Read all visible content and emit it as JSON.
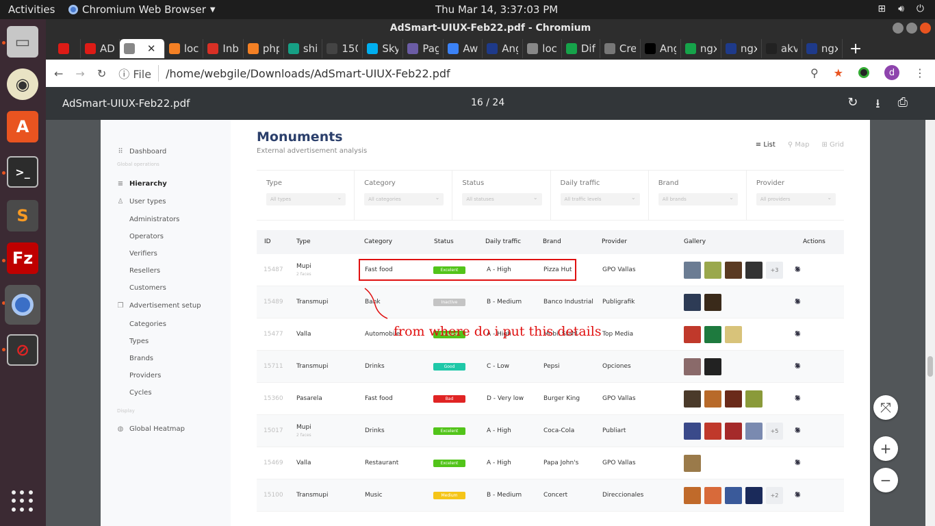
{
  "system": {
    "activities": "Activities",
    "app_name": "Chromium Web Browser",
    "clock": "Thu Mar 14,  3:37:03 PM"
  },
  "dock": {
    "items": [
      "Files",
      "Rhythmbox",
      "Software",
      "Terminal",
      "Sublime",
      "FileZilla",
      "Chromium",
      "Blocked"
    ]
  },
  "window": {
    "title": "AdSmart-UIUX-Feb22.pdf - Chromium"
  },
  "tabs": [
    {
      "label": "",
      "icon": "angular-icon",
      "color": "#dd1b16"
    },
    {
      "label": "AD",
      "icon": "angular-icon",
      "color": "#dd1b16"
    },
    {
      "label": "",
      "icon": "document-icon",
      "color": "#888888",
      "active": true
    },
    {
      "label": "loc",
      "icon": "stack-icon",
      "color": "#f48024"
    },
    {
      "label": "Inb",
      "icon": "gmail-icon",
      "color": "#d93025"
    },
    {
      "label": "php",
      "icon": "stack-icon",
      "color": "#f48024"
    },
    {
      "label": "shi",
      "icon": "at-icon",
      "color": "#16a085"
    },
    {
      "label": "150",
      "icon": "cloud-icon",
      "color": "#444444"
    },
    {
      "label": "Sky",
      "icon": "skype-icon",
      "color": "#00aff0"
    },
    {
      "label": "Pag",
      "icon": "p-icon",
      "color": "#6b5ca5"
    },
    {
      "label": "Aw",
      "icon": "circle-icon",
      "color": "#3b82f6"
    },
    {
      "label": "Ang",
      "icon": "b-icon",
      "color": "#1e3a8a"
    },
    {
      "label": "loc",
      "icon": "document-icon",
      "color": "#888888"
    },
    {
      "label": "Dif",
      "icon": "d-icon",
      "color": "#16a34a"
    },
    {
      "label": "Cre",
      "icon": "gear-icon",
      "color": "#777777"
    },
    {
      "label": "Ang",
      "icon": "m-icon",
      "color": "#000000"
    },
    {
      "label": "ngx",
      "icon": "chart-icon",
      "color": "#16a34a"
    },
    {
      "label": "ngx",
      "icon": "grid-icon",
      "color": "#1e3a8a"
    },
    {
      "label": "akv",
      "icon": "github-icon",
      "color": "#222222"
    },
    {
      "label": "ngx",
      "icon": "grid-icon",
      "color": "#1e3a8a"
    }
  ],
  "omnibox": {
    "scheme_label": "File",
    "url": "/home/webgile/Downloads/AdSmart-UIUX-Feb22.pdf",
    "avatar_letter": "d"
  },
  "pdf": {
    "filename": "AdSmart-UIUX-Feb22.pdf",
    "page_indicator": "16 / 24"
  },
  "sidebar": {
    "items": [
      {
        "label": "Dashboard",
        "icon": "grid-icon"
      },
      {
        "label": "Global operations",
        "section": true
      },
      {
        "label": "Hierarchy",
        "icon": "hierarchy-icon",
        "active": true
      },
      {
        "label": "User types",
        "icon": "user-icon"
      },
      {
        "label": "Administrators"
      },
      {
        "label": "Operators"
      },
      {
        "label": "Verifiers"
      },
      {
        "label": "Resellers"
      },
      {
        "label": "Customers"
      },
      {
        "label": "Advertisement setup",
        "icon": "copy-icon"
      },
      {
        "label": "Categories"
      },
      {
        "label": "Types"
      },
      {
        "label": "Brands"
      },
      {
        "label": "Providers"
      },
      {
        "label": "Cycles"
      },
      {
        "label": "Display",
        "section": true
      },
      {
        "label": "Global Heatmap",
        "icon": "globe-icon"
      }
    ]
  },
  "main": {
    "title": "Monuments",
    "subtitle": "External advertisement analysis",
    "views": [
      "List",
      "Map",
      "Grid"
    ],
    "filters": [
      {
        "label": "Type",
        "placeholder": "All types"
      },
      {
        "label": "Category",
        "placeholder": "All categories"
      },
      {
        "label": "Status",
        "placeholder": "All statuses"
      },
      {
        "label": "Daily traffic",
        "placeholder": "All traffic levels"
      },
      {
        "label": "Brand",
        "placeholder": "All brands"
      },
      {
        "label": "Provider",
        "placeholder": "All providers"
      }
    ],
    "columns": [
      "ID",
      "Type",
      "Category",
      "Status",
      "Daily traffic",
      "Brand",
      "Provider",
      "Gallery",
      "Actions"
    ],
    "rows": [
      {
        "id": "15487",
        "type": "Mupi",
        "sub": "2 faces",
        "category": "Fast food",
        "status": "Excelent",
        "status_color": "#52c41a",
        "traffic": "A - High",
        "brand": "Pizza Hut",
        "provider": "GPO Vallas",
        "thumbs": [
          "#6b7c93",
          "#9aa84c",
          "#5a3a22",
          "#333333"
        ],
        "more": "+3"
      },
      {
        "id": "15489",
        "type": "Transmupi",
        "sub": "",
        "category": "Bank",
        "status": "Inactive",
        "status_color": "#c4c4c4",
        "traffic": "B - Medium",
        "brand": "Banco Industrial",
        "provider": "Publigrafik",
        "thumbs": [
          "#2d3b55",
          "#3a2a1a"
        ],
        "more": ""
      },
      {
        "id": "15477",
        "type": "Valla",
        "sub": "",
        "category": "Automobile",
        "status": "Excelent",
        "status_color": "#52c41a",
        "traffic": "A - High",
        "brand": "Mobil Stahl",
        "provider": "Top Media",
        "thumbs": [
          "#c0392b",
          "#1e7a3e",
          "#d8c37a"
        ],
        "more": ""
      },
      {
        "id": "15711",
        "type": "Transmupi",
        "sub": "",
        "category": "Drinks",
        "status": "Good",
        "status_color": "#1fc8a8",
        "traffic": "C - Low",
        "brand": "Pepsi",
        "provider": "Opciones",
        "thumbs": [
          "#8a6a6a",
          "#222222"
        ],
        "more": ""
      },
      {
        "id": "15360",
        "type": "Pasarela",
        "sub": "",
        "category": "Fast food",
        "status": "Bad",
        "status_color": "#e02424",
        "traffic": "D - Very low",
        "brand": "Burger King",
        "provider": "GPO Vallas",
        "thumbs": [
          "#4a3a2a",
          "#b86a2a",
          "#6a2a1a",
          "#8a9a3a"
        ],
        "more": ""
      },
      {
        "id": "15017",
        "type": "Mupi",
        "sub": "2 faces",
        "category": "Drinks",
        "status": "Excelent",
        "status_color": "#52c41a",
        "traffic": "A - High",
        "brand": "Coca-Cola",
        "provider": "Publiart",
        "thumbs": [
          "#3a4a8a",
          "#c0392b",
          "#a52a2a",
          "#7a8ab0"
        ],
        "more": "+5"
      },
      {
        "id": "15469",
        "type": "Valla",
        "sub": "",
        "category": "Restaurant",
        "status": "Excelent",
        "status_color": "#52c41a",
        "traffic": "A - High",
        "brand": "Papa John's",
        "provider": "GPO Vallas",
        "thumbs": [
          "#9a7a4a"
        ],
        "more": ""
      },
      {
        "id": "15100",
        "type": "Transmupi",
        "sub": "",
        "category": "Music",
        "status": "Medium",
        "status_color": "#f5c518",
        "traffic": "B - Medium",
        "brand": "Concert",
        "provider": "Direccionales",
        "thumbs": [
          "#c06a2a",
          "#d86a3a",
          "#3a5a9a",
          "#1a2a5a"
        ],
        "more": "+2"
      }
    ]
  },
  "annotation": {
    "text": "from where do i put this details"
  }
}
